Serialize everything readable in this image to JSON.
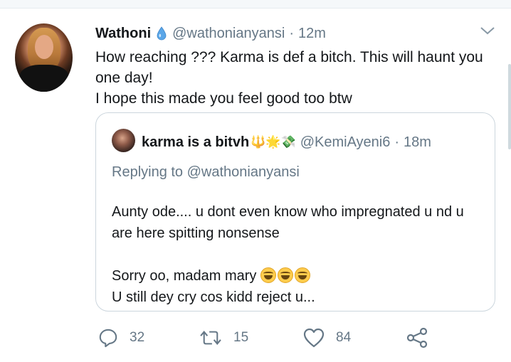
{
  "tweet": {
    "author_name": "Wathoni",
    "verified_icon": "droplet-emoji",
    "handle": "@wathonianyansi",
    "separator": "·",
    "time": "12m",
    "text_line1": "How reaching ??? Karma is def a bitch. This will haunt you one day!",
    "text_line2": "I hope this made you feel good too btw",
    "menu_icon": "chevron-down-icon"
  },
  "quoted_tweet": {
    "author_name": "karma is a bitvh",
    "name_emojis": "🔱🌟💸",
    "handle": "@KemiAyeni6",
    "separator": "·",
    "time": "18m",
    "replying_prefix": "Replying to ",
    "replying_to": "@wathonianyansi",
    "body_line1": "Aunty ode.... u dont even know who impregnated u nd u are here spitting nonsense",
    "body_line2": "Sorry oo, madam mary ",
    "body_line3": "U still dey cry cos kidd reject u..."
  },
  "actions": {
    "reply": {
      "icon": "reply-icon",
      "count": "32"
    },
    "retweet": {
      "icon": "retweet-icon",
      "count": "15"
    },
    "like": {
      "icon": "heart-icon",
      "count": "84"
    },
    "share": {
      "icon": "share-icon"
    }
  },
  "colors": {
    "text_primary": "#14171a",
    "text_secondary": "#657786",
    "border": "#ccd6dd",
    "droplet": "#4a90d9"
  }
}
